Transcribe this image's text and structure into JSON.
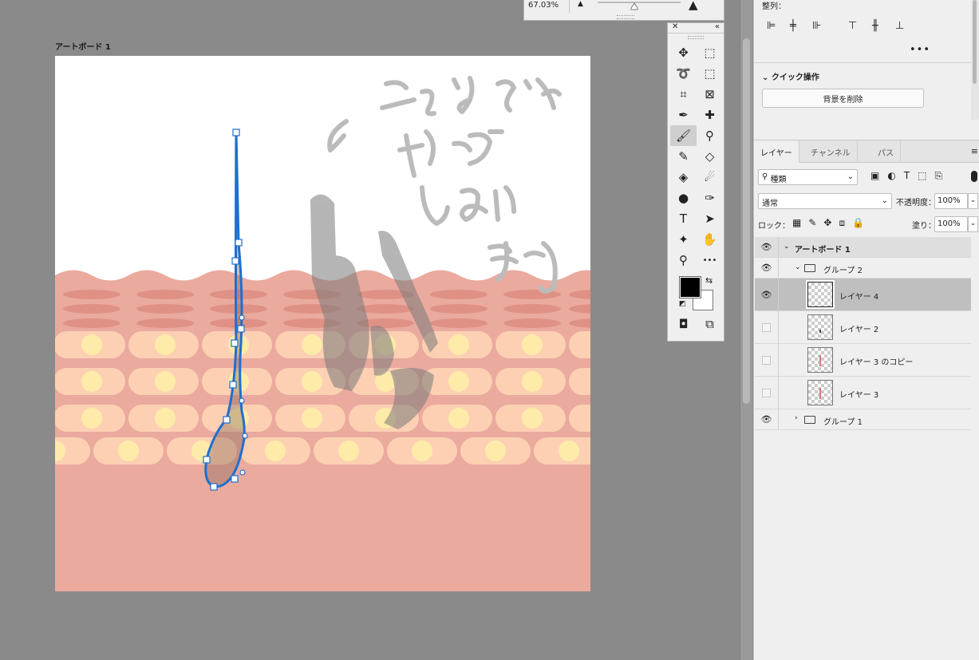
{
  "canvas": {
    "artboard_label": "アートボード 1",
    "handwriting_lines": [
      "こんなように",
      "なって",
      "しまい",
      "ます"
    ]
  },
  "navigator": {
    "zoom": "67.03%"
  },
  "toolbar": {
    "tools": [
      {
        "name": "move-tool-icon",
        "glyph": "✥"
      },
      {
        "name": "marquee-tool-icon",
        "glyph": "⬚"
      },
      {
        "name": "lasso-tool-icon",
        "glyph": "➰"
      },
      {
        "name": "object-select-tool-icon",
        "glyph": "⬚"
      },
      {
        "name": "crop-tool-icon",
        "glyph": "⌗"
      },
      {
        "name": "frame-tool-icon",
        "glyph": "⊠"
      },
      {
        "name": "eyedropper-tool-icon",
        "glyph": "✒"
      },
      {
        "name": "healing-brush-tool-icon",
        "glyph": "✚"
      },
      {
        "name": "brush-tool-icon",
        "glyph": "🖌",
        "active": true
      },
      {
        "name": "stamp-tool-icon",
        "glyph": "⚲"
      },
      {
        "name": "history-brush-tool-icon",
        "glyph": "✎"
      },
      {
        "name": "eraser-tool-icon",
        "glyph": "◇"
      },
      {
        "name": "paint-bucket-tool-icon",
        "glyph": "◈"
      },
      {
        "name": "blur-tool-icon",
        "glyph": "☄"
      },
      {
        "name": "dodge-tool-icon",
        "glyph": "●"
      },
      {
        "name": "pen-tool-icon",
        "glyph": "✑"
      },
      {
        "name": "type-tool-icon",
        "glyph": "T"
      },
      {
        "name": "path-select-tool-icon",
        "glyph": "➤"
      },
      {
        "name": "shape-tool-icon",
        "glyph": "✦"
      },
      {
        "name": "hand-tool-icon",
        "glyph": "✋"
      },
      {
        "name": "zoom-tool-icon",
        "glyph": "⚲"
      },
      {
        "name": "more-tools-icon",
        "glyph": "•••"
      }
    ],
    "foreground_color": "#000000",
    "background_color": "#ffffff"
  },
  "align_panel": {
    "title": "整列："
  },
  "quick_actions": {
    "title": "クイック操作",
    "remove_background": "背景を削除"
  },
  "layers_panel": {
    "tabs": [
      "レイヤー",
      "チャンネル",
      "パス"
    ],
    "filter_kind": "種類",
    "blend_mode": "通常",
    "opacity_label": "不透明度：",
    "opacity_value": "100%",
    "lock_label": "ロック：",
    "fill_label": "塗り：",
    "fill_value": "100%",
    "layers": [
      {
        "name": "アートボード 1",
        "visible": true
      },
      {
        "name": "グループ 2",
        "visible": true
      },
      {
        "name": "レイヤー 4",
        "visible": true,
        "selected": true
      },
      {
        "name": "レイヤー 2",
        "visible": false
      },
      {
        "name": "レイヤー 3 のコピー",
        "visible": false
      },
      {
        "name": "レイヤー 3",
        "visible": false
      },
      {
        "name": "グループ 1",
        "visible": true
      }
    ]
  }
}
